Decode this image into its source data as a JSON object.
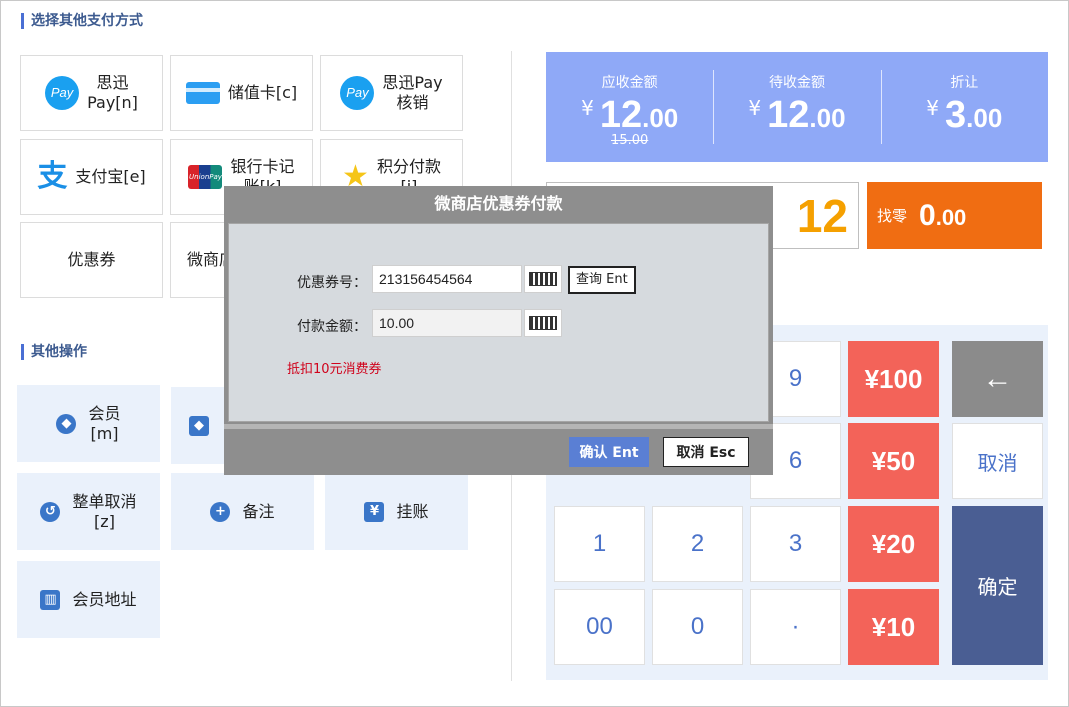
{
  "sections": {
    "payment_title": "选择其他支付方式",
    "operations_title": "其他操作"
  },
  "payment_methods": [
    {
      "icon": "pay-icon",
      "icon_text": "Pay",
      "label": "思迅\nPay[n]"
    },
    {
      "icon": "card-icon",
      "icon_text": "",
      "label": "储值卡[c]"
    },
    {
      "icon": "pay-icon",
      "icon_text": "Pay",
      "label": "思迅Pay\n核销"
    },
    {
      "icon": "alipay-icon",
      "icon_text": "支",
      "label": "支付宝[e]"
    },
    {
      "icon": "unionpay-icon",
      "icon_text": "UnionPay",
      "label": "银行卡记\n账[k]"
    },
    {
      "icon": "star-icon",
      "icon_text": "★",
      "label": "积分付款\n[j]"
    },
    {
      "icon": "",
      "icon_text": "",
      "label": "优惠券"
    },
    {
      "icon": "",
      "icon_text": "",
      "label": "微商店"
    }
  ],
  "operations": [
    {
      "icon": "diamond-icon",
      "icon_text": "◆",
      "label": "会员\n[m]"
    },
    {
      "icon": "tag-icon",
      "icon_text": "◆",
      "label": ""
    },
    {
      "icon": "undo-icon",
      "icon_text": "↺",
      "label": "整单取消\n[z]"
    },
    {
      "icon": "plus-icon",
      "icon_text": "+",
      "label": "备注"
    },
    {
      "icon": "yen-doc-icon",
      "icon_text": "¥",
      "label": "挂账"
    },
    {
      "icon": "building-icon",
      "icon_text": "▥",
      "label": "会员地址"
    }
  ],
  "summary": {
    "receivable": {
      "label": "应收金额",
      "currency": "¥",
      "int": "12",
      "dec": ".00",
      "original": "15.00"
    },
    "pending": {
      "label": "待收金额",
      "currency": "¥",
      "int": "12",
      "dec": ".00"
    },
    "discount": {
      "label": "折让",
      "currency": "¥",
      "int": "3",
      "dec": ".00"
    }
  },
  "input_value": "12",
  "change": {
    "label": "找零",
    "int": "0",
    "dec": ".00"
  },
  "keypad": {
    "k9": "9",
    "k6": "6",
    "k1": "1",
    "k2": "2",
    "k3": "3",
    "k00": "00",
    "k0": "0",
    "kdot": "·",
    "y100": "¥100",
    "y50": "¥50",
    "y20": "¥20",
    "y10": "¥10",
    "backspace": "←",
    "cancel": "取消",
    "confirm": "确定"
  },
  "modal": {
    "title": "微商店优惠券付款",
    "coupon_label": "优惠券号：",
    "coupon_value": "213156454564",
    "query_button": "查询 Ent",
    "amount_label": "付款金额：",
    "amount_value": "10.00",
    "note": "抵扣10元消费券",
    "ok_button": "确认 Ent",
    "cancel_button": "取消 Esc"
  }
}
